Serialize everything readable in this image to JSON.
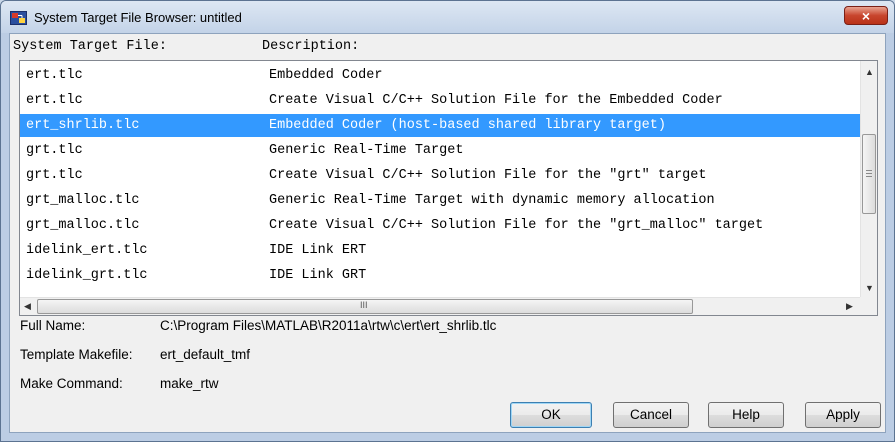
{
  "window": {
    "title": "System Target File Browser: untitled",
    "close_glyph": "×"
  },
  "columns": {
    "file": "System Target File:",
    "description": "Description:"
  },
  "rows": [
    {
      "file": "ert.tlc",
      "description": "Embedded Coder",
      "selected": false
    },
    {
      "file": "ert.tlc",
      "description": "Create Visual C/C++ Solution File for the Embedded Coder",
      "selected": false
    },
    {
      "file": "ert_shrlib.tlc",
      "description": "Embedded Coder (host-based shared library target)",
      "selected": true
    },
    {
      "file": "grt.tlc",
      "description": "Generic Real-Time Target",
      "selected": false
    },
    {
      "file": "grt.tlc",
      "description": "Create Visual C/C++ Solution File for the \"grt\" target",
      "selected": false
    },
    {
      "file": "grt_malloc.tlc",
      "description": "Generic Real-Time Target with dynamic memory allocation",
      "selected": false
    },
    {
      "file": "grt_malloc.tlc",
      "description": "Create Visual C/C++ Solution File for the \"grt_malloc\" target",
      "selected": false
    },
    {
      "file": "idelink_ert.tlc",
      "description": "IDE Link ERT",
      "selected": false
    },
    {
      "file": "idelink_grt.tlc",
      "description": "IDE Link GRT",
      "selected": false
    }
  ],
  "details": {
    "full_name_label": "Full Name:",
    "full_name_value": "C:\\Program Files\\MATLAB\\R2011a\\rtw\\c\\ert\\ert_shrlib.tlc",
    "template_label": "Template Makefile:",
    "template_value": "ert_default_tmf",
    "make_label": "Make Command:",
    "make_value": "make_rtw"
  },
  "buttons": {
    "ok": "OK",
    "cancel": "Cancel",
    "help": "Help",
    "apply": "Apply"
  },
  "colors": {
    "selection": "#3399ff",
    "close_button": "#c8452d"
  },
  "icons": {
    "app": "simulink-model-icon",
    "close": "close-icon"
  }
}
